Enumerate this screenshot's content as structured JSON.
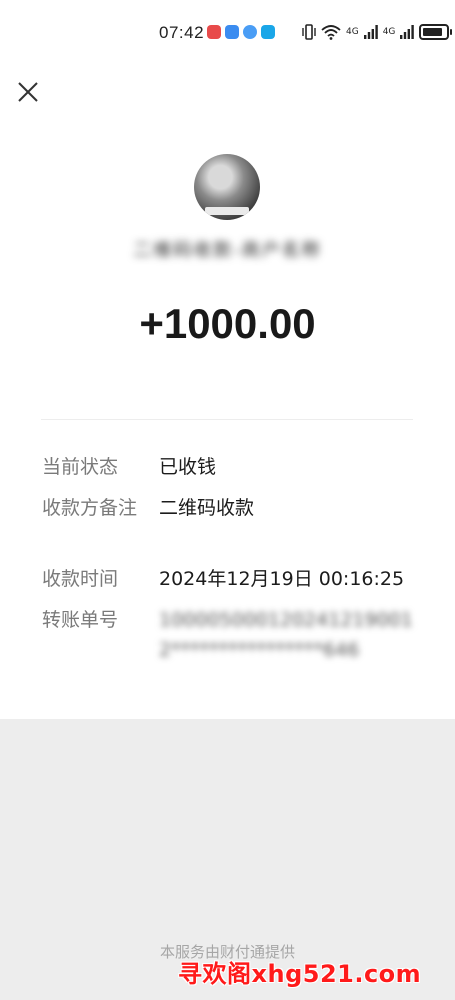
{
  "status_bar": {
    "time": "07:42",
    "notifications": [
      "red-app-icon",
      "blue-app-icon",
      "browser-icon",
      "search-app-icon"
    ],
    "signal_label_1": "4G",
    "signal_label_2": "4G"
  },
  "nav": {
    "close_icon": "close-icon"
  },
  "transaction": {
    "merchant_name": "二维码收款-商户名称",
    "amount": "+1000.00",
    "details": [
      {
        "label": "当前状态",
        "value": "已收钱"
      },
      {
        "label": "收款方备注",
        "value": "二维码收款"
      },
      {
        "label": "收款时间",
        "value": "2024年12月19日 00:16:25"
      },
      {
        "label": "转账单号",
        "value": "1000050001202412190012****************646"
      }
    ]
  },
  "footer": {
    "provider": "本服务由财付通提供",
    "watermark": "寻欢阁xhg521.com"
  },
  "colors": {
    "background": "#ededed",
    "card": "#ffffff",
    "label": "#7a7a7a",
    "watermark": "#ff1a1a"
  }
}
